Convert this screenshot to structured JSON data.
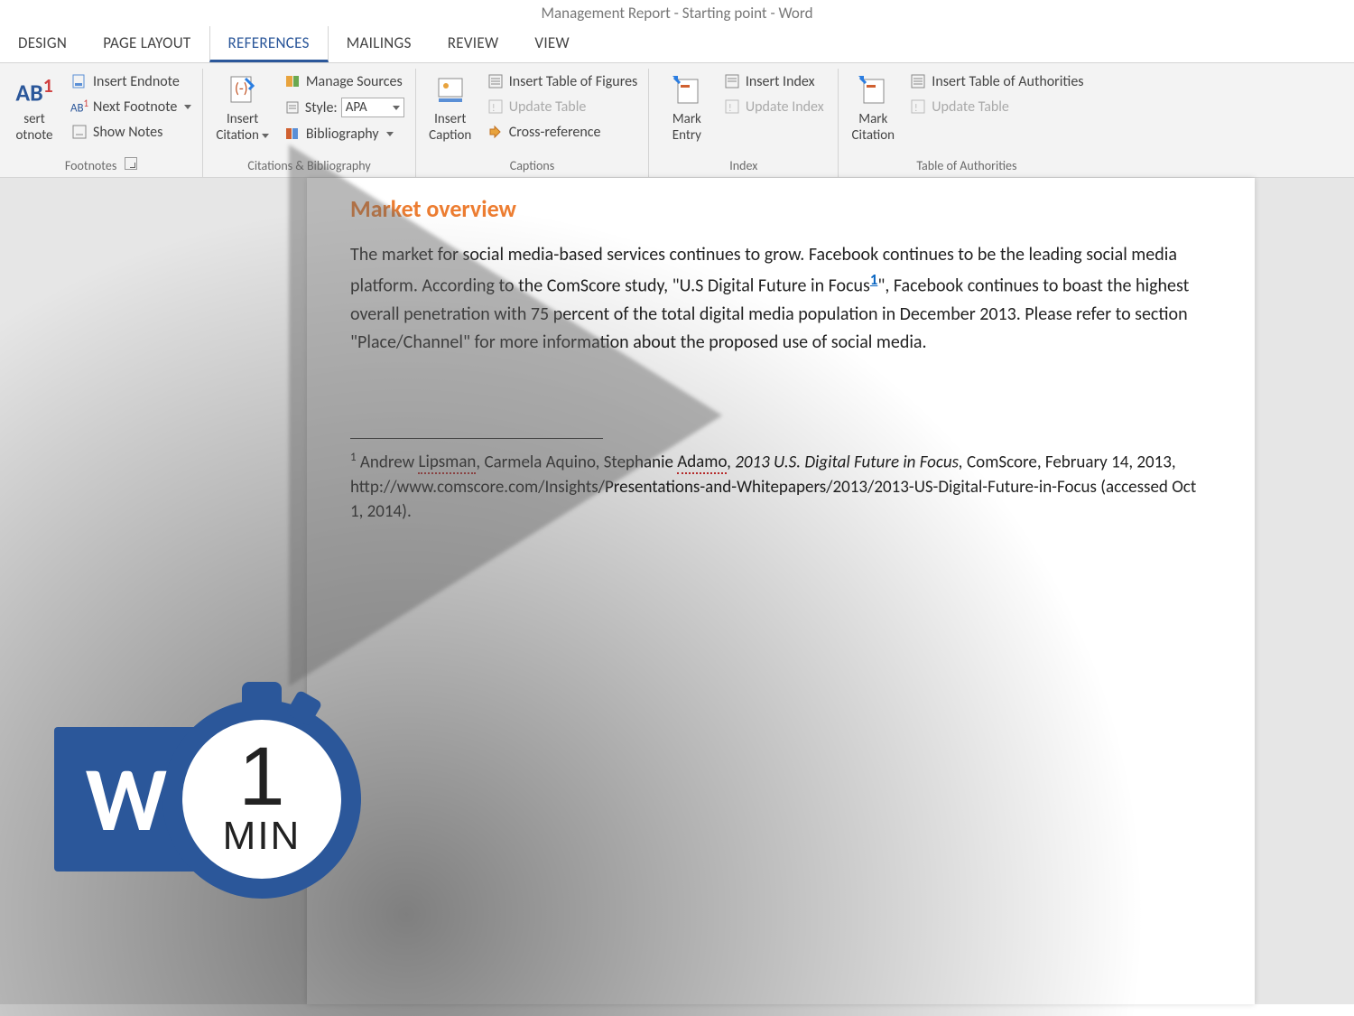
{
  "title": "Management Report - Starting point - Word",
  "tabs": [
    "DESIGN",
    "PAGE LAYOUT",
    "REFERENCES",
    "MAILINGS",
    "REVIEW",
    "VIEW"
  ],
  "active_tab": 2,
  "ribbon": {
    "footnotes": {
      "label": "Footnotes",
      "insert_footnote_big_top": "AB¹",
      "insert_footnote_big_l1": "sert",
      "insert_footnote_big_l2": "otnote",
      "insert_endnote": "Insert Endnote",
      "next_footnote": "Next Footnote",
      "show_notes": "Show Notes"
    },
    "citations": {
      "label": "Citations & Bibliography",
      "insert_citation": "Insert",
      "insert_citation2": "Citation",
      "manage_sources": "Manage Sources",
      "style_label": "Style:",
      "style_value": "APA",
      "bibliography": "Bibliography"
    },
    "captions": {
      "label": "Captions",
      "insert_caption": "Insert",
      "insert_caption2": "Caption",
      "insert_table_figures": "Insert Table of Figures",
      "update_table": "Update Table",
      "cross_reference": "Cross-reference"
    },
    "index": {
      "label": "Index",
      "mark_entry": "Mark",
      "mark_entry2": "Entry",
      "insert_index": "Insert Index",
      "update_index": "Update Index"
    },
    "authorities": {
      "label": "Table of Authorities",
      "mark_citation": "Mark",
      "mark_citation2": "Citation",
      "insert_toa": "Insert Table of Authorities",
      "update_table": "Update Table"
    }
  },
  "document": {
    "heading": "Market overview",
    "body_p1_a": "The market for social media-based services continues to grow. Facebook continues to be the leading social media platform.  According to the ComScore study, \"U.S Digital Future in Focus",
    "body_p1_ref": "1",
    "body_p1_b": "\", Facebook continues to boast the highest overall penetration with 75 percent of the total digital media population in December 2013. Please refer to section \"Place/Channel\" for more information about the proposed use of social media.",
    "footnote_num": "1",
    "footnote_a": " Andrew ",
    "footnote_name1": "Lipsman",
    "footnote_b": ", Carmela Aquino, Stephanie ",
    "footnote_name2": "Adamo",
    "footnote_c": ", ",
    "footnote_italic": "2013 U.S. Digital Future in Focus,",
    "footnote_d": " ComScore, February 14, 2013, http://www.comscore.com/Insights/Presentations-and-Whitepapers/2013/2013-US-Digital-Future-in-Focus (accessed Oct 1, 2014)."
  },
  "badge": {
    "word_letter": "W",
    "num": "1",
    "min": "MIN"
  }
}
